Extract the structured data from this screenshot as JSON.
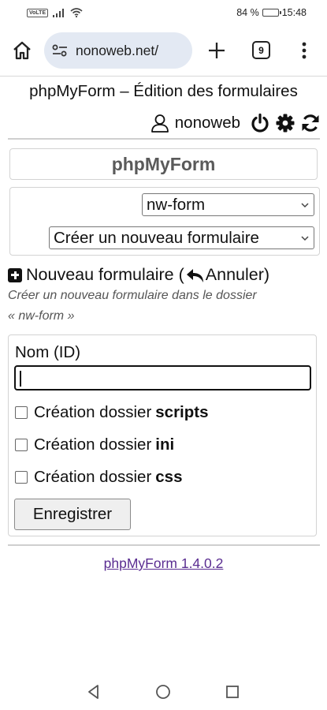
{
  "status_bar": {
    "network_badge": "VoLTE",
    "battery_text": "84 %",
    "battery_level": 0.84,
    "time": "15:48",
    "icons": [
      "signal-icon",
      "wifi-icon",
      "battery-icon"
    ]
  },
  "browser": {
    "url": "nonoweb.net/",
    "tab_count": "9",
    "icons": [
      "home-icon",
      "site-settings-icon",
      "new-tab-icon",
      "menu-icon"
    ]
  },
  "header": {
    "title": "phpMyForm – Édition des formulaires",
    "user_name": "nonoweb",
    "icons": [
      "user-icon",
      "power-icon",
      "gear-icon",
      "refresh-icon"
    ]
  },
  "brand": {
    "name": "phpMyForm"
  },
  "selectors": {
    "folder_value": "nw-form",
    "form_value": "Créer un nouveau formulaire"
  },
  "section": {
    "title_pre": "Nouveau formulaire (",
    "cancel_label": "Annuler",
    "title_post": ")",
    "hint_line1": "Créer un nouveau formulaire dans le dossier",
    "hint_line2": "« nw-form »"
  },
  "form": {
    "name_label": "Nom (ID)",
    "name_value": "",
    "checkboxes": [
      {
        "prefix": "Création dossier",
        "name": "scripts",
        "checked": false
      },
      {
        "prefix": "Création dossier",
        "name": "ini",
        "checked": false
      },
      {
        "prefix": "Création dossier",
        "name": "css",
        "checked": false
      }
    ],
    "submit_label": "Enregistrer"
  },
  "footer": {
    "link_text": "phpMyForm 1.4.0.2"
  },
  "colors": {
    "url_pill_bg": "#e3e9f3",
    "link_color": "#5a2d91",
    "brand_text": "#5a5a5a"
  }
}
